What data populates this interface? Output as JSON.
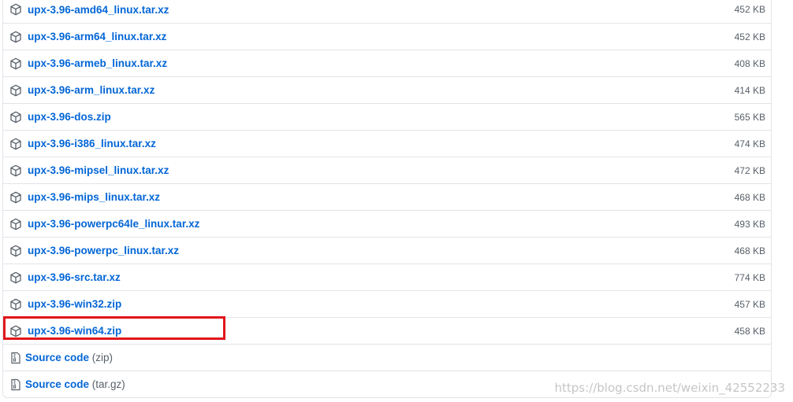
{
  "assets": [
    {
      "name": "upx-3.96-amd64_linux.tar.xz",
      "size": "452 KB",
      "icon": "package-icon"
    },
    {
      "name": "upx-3.96-arm64_linux.tar.xz",
      "size": "452 KB",
      "icon": "package-icon"
    },
    {
      "name": "upx-3.96-armeb_linux.tar.xz",
      "size": "408 KB",
      "icon": "package-icon"
    },
    {
      "name": "upx-3.96-arm_linux.tar.xz",
      "size": "414 KB",
      "icon": "package-icon"
    },
    {
      "name": "upx-3.96-dos.zip",
      "size": "565 KB",
      "icon": "package-icon"
    },
    {
      "name": "upx-3.96-i386_linux.tar.xz",
      "size": "474 KB",
      "icon": "package-icon"
    },
    {
      "name": "upx-3.96-mipsel_linux.tar.xz",
      "size": "472 KB",
      "icon": "package-icon"
    },
    {
      "name": "upx-3.96-mips_linux.tar.xz",
      "size": "468 KB",
      "icon": "package-icon"
    },
    {
      "name": "upx-3.96-powerpc64le_linux.tar.xz",
      "size": "493 KB",
      "icon": "package-icon"
    },
    {
      "name": "upx-3.96-powerpc_linux.tar.xz",
      "size": "468 KB",
      "icon": "package-icon"
    },
    {
      "name": "upx-3.96-src.tar.xz",
      "size": "774 KB",
      "icon": "package-icon"
    },
    {
      "name": "upx-3.96-win32.zip",
      "size": "457 KB",
      "icon": "package-icon"
    },
    {
      "name": "upx-3.96-win64.zip",
      "size": "458 KB",
      "icon": "package-icon",
      "highlighted": true
    }
  ],
  "source_code": [
    {
      "label": "Source code",
      "suffix": "(zip)",
      "icon": "file-zip-icon"
    },
    {
      "label": "Source code",
      "suffix": "(tar.gz)",
      "icon": "file-zip-icon"
    }
  ],
  "watermark": "https://blog.csdn.net/weixin_42552233",
  "colors": {
    "link": "#0366d6",
    "muted": "#586069",
    "border": "#e1e4e8",
    "highlight": "#e0161c"
  }
}
